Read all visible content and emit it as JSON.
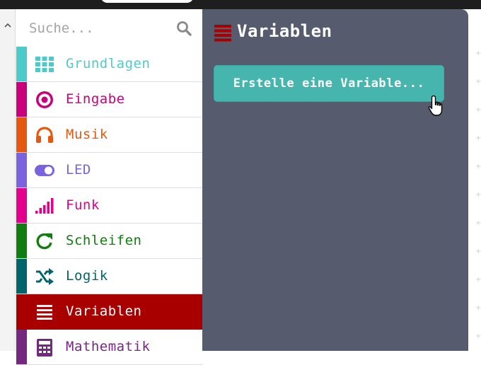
{
  "search": {
    "placeholder": "Suche..."
  },
  "categories": [
    {
      "label": "Grundlagen",
      "color": "#4dcbcb",
      "icon": "grid-icon"
    },
    {
      "label": "Eingabe",
      "color": "#c8007a",
      "icon": "target-circle-icon"
    },
    {
      "label": "Musik",
      "color": "#e45912",
      "icon": "headphones-icon"
    },
    {
      "label": "LED",
      "color": "#7b63df",
      "icon": "toggle-icon"
    },
    {
      "label": "Funk",
      "color": "#e3008c",
      "icon": "signal-bars-icon"
    },
    {
      "label": "Schleifen",
      "color": "#117c10",
      "icon": "refresh-icon"
    },
    {
      "label": "Logik",
      "color": "#00646b",
      "icon": "shuffle-icon"
    },
    {
      "label": "Variablen",
      "color": "#a80000",
      "icon": "list-lines-icon",
      "selected": true
    },
    {
      "label": "Mathematik",
      "color": "#732a7e",
      "icon": "calculator-icon"
    }
  ],
  "flyout": {
    "title": "Variablen",
    "background": "#565b6d",
    "make_variable_label": "Erstelle eine Variable...",
    "make_variable_color": "#46b5ad"
  }
}
